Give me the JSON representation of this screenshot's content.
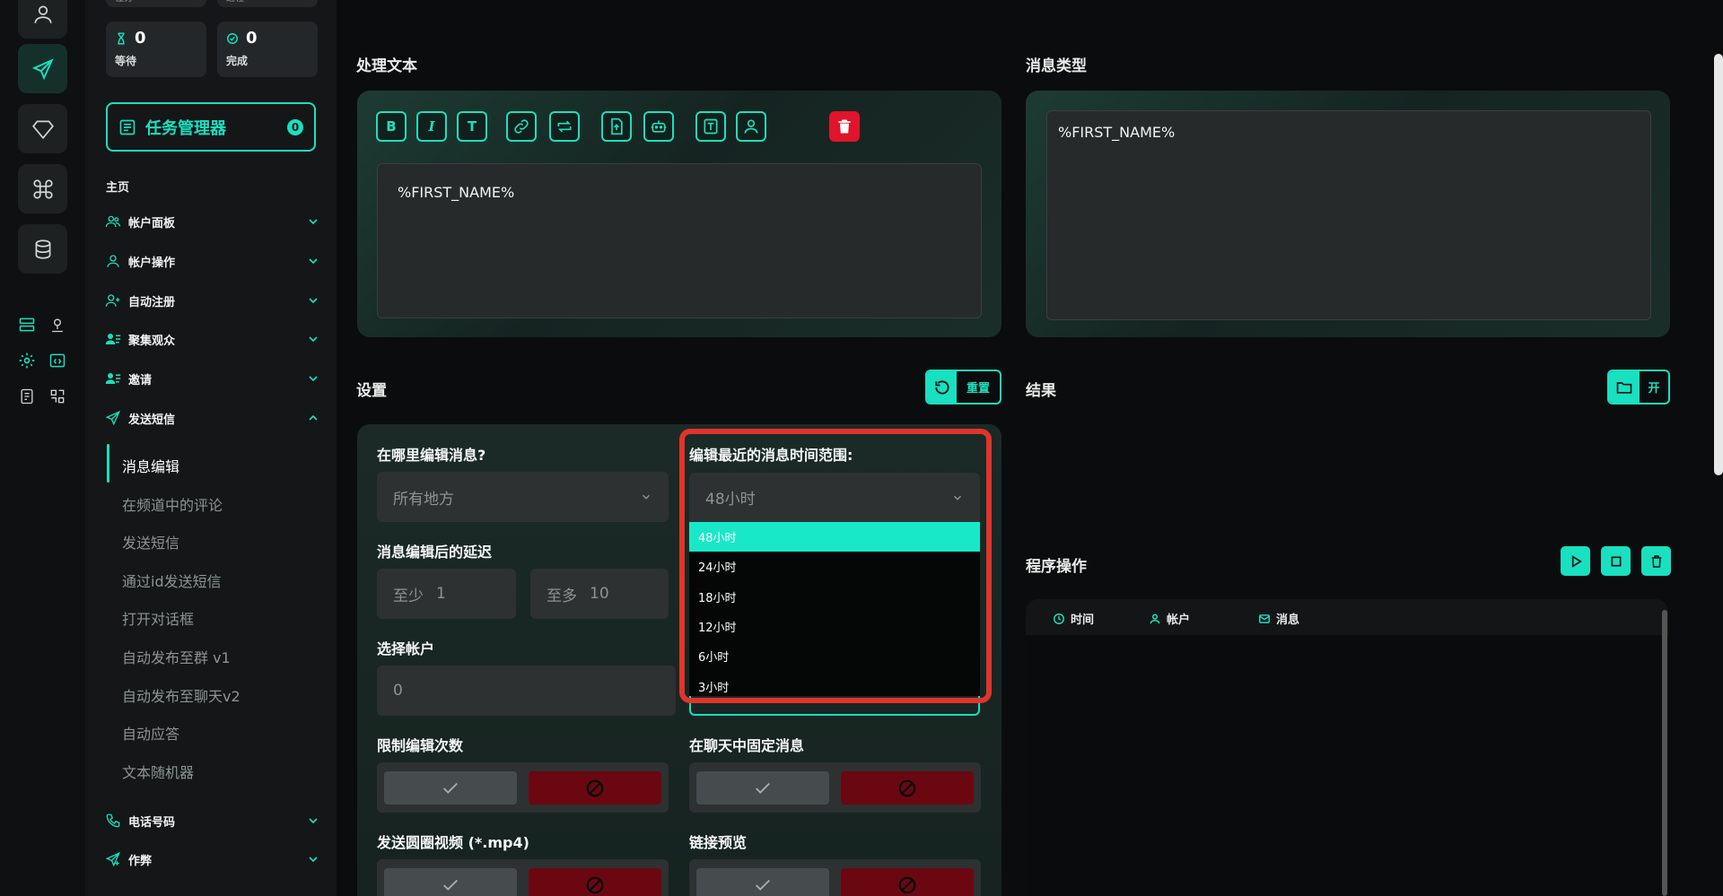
{
  "stats": {
    "top_left_label": "任务",
    "top_right_label": "进程",
    "waiting": {
      "value": "0",
      "label": "等待"
    },
    "done": {
      "value": "0",
      "label": "完成"
    }
  },
  "task_manager": {
    "label": "任务管理器",
    "badge": "0"
  },
  "sidebar": {
    "home_label": "主页",
    "items": [
      {
        "label": "帐户面板"
      },
      {
        "label": "帐户操作"
      },
      {
        "label": "自动注册"
      },
      {
        "label": "聚集观众"
      },
      {
        "label": "邀请"
      },
      {
        "label": "发送短信"
      },
      {
        "label": "电话号码"
      },
      {
        "label": "作弊"
      }
    ],
    "sub_items": [
      {
        "label": "消息编辑"
      },
      {
        "label": "在频道中的评论"
      },
      {
        "label": "发送短信"
      },
      {
        "label": "通过id发送短信"
      },
      {
        "label": "打开对话框"
      },
      {
        "label": "自动发布至群 v1"
      },
      {
        "label": "自动发布至聊天v2"
      },
      {
        "label": "自动应答"
      },
      {
        "label": "文本随机器"
      }
    ]
  },
  "editor": {
    "title": "处理文本",
    "toolbar": [
      "B",
      "I",
      "T"
    ],
    "text": "%FIRST_NAME%"
  },
  "message_type": {
    "title": "消息类型",
    "text": "%FIRST_NAME%"
  },
  "settings": {
    "title": "设置",
    "reset_label": "重置",
    "where_label": "在哪里编辑消息?",
    "where_value": "所有地方",
    "range_label": "编辑最近的消息时间范围:",
    "range_value": "48小时",
    "delay_label": "消息编辑后的延迟",
    "delay_min": {
      "prefix": "至少",
      "value": "1"
    },
    "delay_max": {
      "prefix": "至多",
      "value": "10"
    },
    "accounts_label": "选择帐户",
    "accounts_value": "0",
    "limit_label": "限制编辑次数",
    "pin_label": "在聊天中固定消息",
    "video_label": "发送圆圈视频 (*.mp4)",
    "preview_label": "链接预览"
  },
  "dropdown": {
    "options": [
      {
        "label": "48小时",
        "selected": true
      },
      {
        "label": "24小时"
      },
      {
        "label": "18小时"
      },
      {
        "label": "12小时"
      },
      {
        "label": "6小时"
      },
      {
        "label": "3小时"
      }
    ]
  },
  "results": {
    "title": "结果",
    "open_label": "开"
  },
  "program_ops": {
    "title": "程序操作",
    "columns": [
      "时间",
      "帐户",
      "消息"
    ]
  },
  "colors": {
    "accent": "#19e0c0",
    "danger": "#e0142a",
    "highlight_frame": "#e0342c"
  }
}
